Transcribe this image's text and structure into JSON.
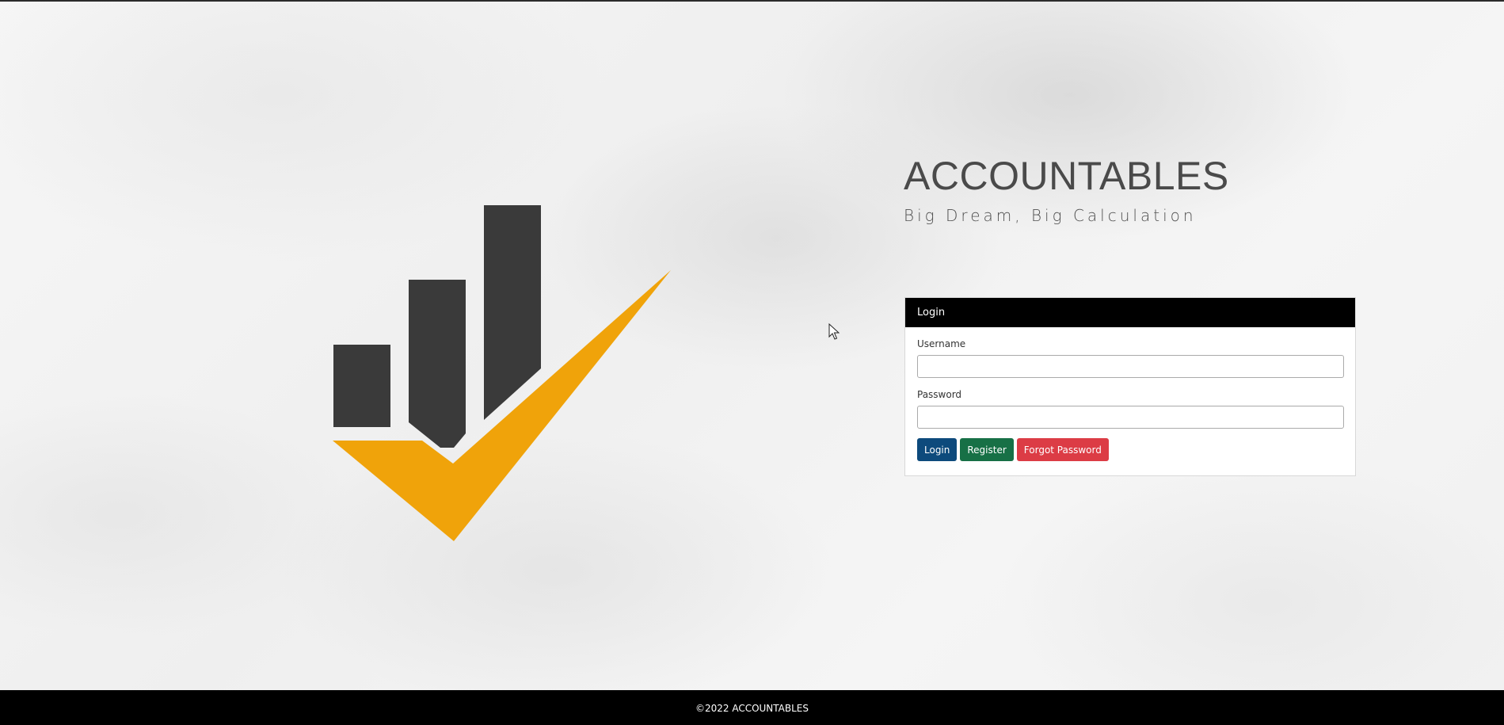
{
  "brand": {
    "title": "ACCOUNTABLES",
    "tagline": "Big Dream, Big Calculation"
  },
  "logo": {
    "icon": "bar-chart-checkmark-logo",
    "bar_color": "#3a3a3a",
    "check_color": "#f0a30a"
  },
  "login": {
    "header": "Login",
    "username_label": "Username",
    "username_value": "",
    "password_label": "Password",
    "password_value": "",
    "login_button": "Login",
    "register_button": "Register",
    "forgot_button": "Forgot Password"
  },
  "colors": {
    "login_button": "#0d4a7c",
    "register_button": "#177046",
    "forgot_button": "#dc3c45",
    "header_bg": "#000000"
  },
  "footer": {
    "text": "©2022 ACCOUNTABLES"
  }
}
